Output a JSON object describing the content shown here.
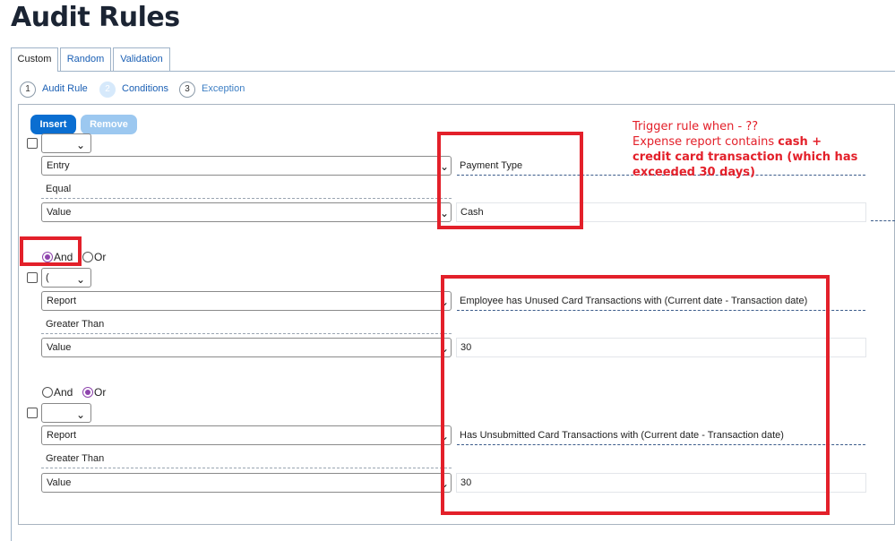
{
  "page": {
    "title": "Audit Rules"
  },
  "tabs": [
    {
      "label": "Custom",
      "active": true
    },
    {
      "label": "Random",
      "active": false
    },
    {
      "label": "Validation",
      "active": false
    }
  ],
  "steps": [
    {
      "number": "1",
      "label": "Audit Rule"
    },
    {
      "number": "2",
      "label": "Conditions",
      "current": true
    },
    {
      "number": "3",
      "label": "Exception"
    }
  ],
  "toolbar": {
    "insert_label": "Insert",
    "remove_label": "Remove"
  },
  "conditions": [
    {
      "paren": "",
      "left_select": "Entry",
      "field": "Payment Type",
      "operator": "Equal",
      "value_select": "Value",
      "value": "Cash"
    },
    {
      "connector": {
        "and_label": "And",
        "or_label": "Or",
        "selected": "And"
      },
      "paren": "(",
      "left_select": "Report",
      "field": "Employee has Unused Card Transactions with (Current date - Transaction date)",
      "operator": "Greater Than",
      "value_select": "Value",
      "value": "30"
    },
    {
      "connector": {
        "and_label": "And",
        "or_label": "Or",
        "selected": "Or"
      },
      "paren": "",
      "left_select": "Report",
      "field": "Has Unsubmitted Card Transactions with (Current date - Transaction date)",
      "operator": "Greater Than",
      "value_select": "Value",
      "value": "30"
    }
  ],
  "annotation": {
    "line1": "Trigger rule when - ??",
    "line2_prefix": "Expense report contains ",
    "line2_bold": "cash +",
    "line3_bold": "credit card transaction (which has",
    "line4_bold": "exceeded 30 days)"
  },
  "colors": {
    "accent": "#0a6ed1",
    "annotation_red": "#e3202a",
    "radio_selected": "#8e44ad"
  },
  "icons": {
    "dropdown": "chevron-down-icon"
  }
}
